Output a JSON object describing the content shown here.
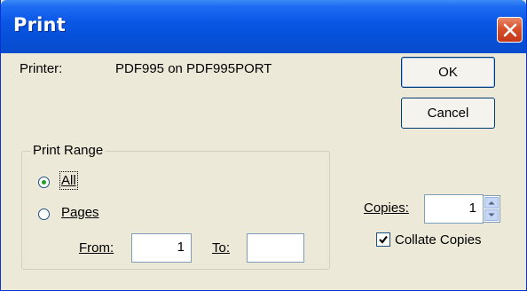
{
  "window": {
    "title": "Print"
  },
  "printer": {
    "label": "Printer:",
    "name": "PDF995 on PDF995PORT"
  },
  "buttons": {
    "ok": "OK",
    "cancel": "Cancel"
  },
  "print_range": {
    "title": "Print Range",
    "all": {
      "label": "All",
      "selected": true
    },
    "pages": {
      "label": "Pages",
      "selected": false
    },
    "from": {
      "label": "From:",
      "value": "1"
    },
    "to": {
      "label": "To:",
      "value": ""
    }
  },
  "copies": {
    "label": "Copies:",
    "value": "1"
  },
  "collate": {
    "label": "Collate Copies",
    "checked": true
  },
  "colors": {
    "title_bar": "#0a58e6",
    "dialog_bg": "#ece9d8",
    "close_button": "#d8502c"
  }
}
